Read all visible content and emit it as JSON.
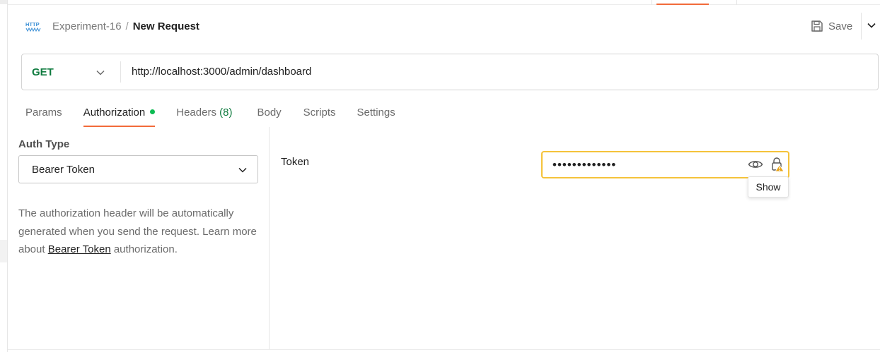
{
  "header": {
    "collection": "Experiment-16",
    "separator": "/",
    "request_name": "New Request",
    "save_label": "Save",
    "http_icon": "http-icon"
  },
  "request": {
    "method": "GET",
    "url": "http://localhost:3000/admin/dashboard"
  },
  "tabs": [
    {
      "label": "Params"
    },
    {
      "label": "Authorization",
      "indicator": "active-dot"
    },
    {
      "label": "Headers",
      "count": "(8)"
    },
    {
      "label": "Body"
    },
    {
      "label": "Scripts"
    },
    {
      "label": "Settings"
    }
  ],
  "auth": {
    "type_label": "Auth Type",
    "type_value": "Bearer Token",
    "desc_before": "The authorization header will be automatically generated when you send the request. Learn more about ",
    "desc_link": "Bearer Token",
    "desc_after": " authorization."
  },
  "token": {
    "label": "Token",
    "masked_value": "•••••••••••••",
    "tooltip": "Show"
  },
  "colors": {
    "accent": "#f26b3a",
    "method_get": "#0f7b3f",
    "active_dot": "#0cbb52",
    "focus_border": "#f5c33b",
    "warning": "#e8a317"
  }
}
